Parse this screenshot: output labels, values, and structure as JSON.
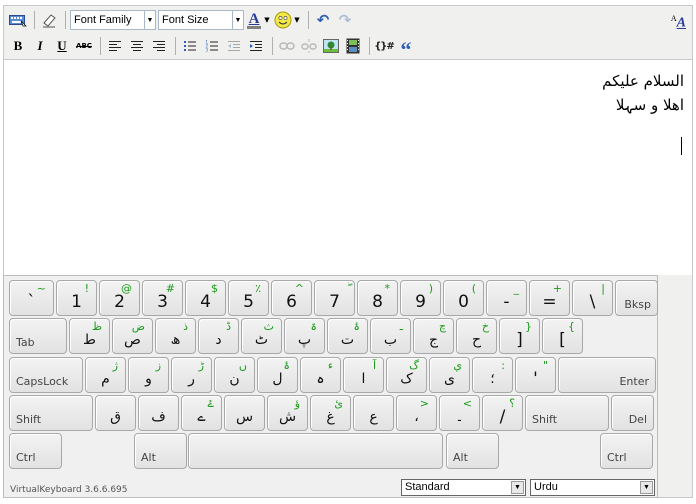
{
  "toolbar": {
    "row1": {
      "keyboard_icon": "keyboard-icon",
      "eraser_icon": "eraser-icon",
      "font_family": "Font Family",
      "font_size": "Font Size",
      "text_color_glyph": "A",
      "emoticon_glyph": "☺",
      "undo_glyph": "↶",
      "redo_glyph": "↷"
    },
    "row2": {
      "bold": "B",
      "italic": "I",
      "underline": "U",
      "strikethrough": "ABC",
      "quote_glyph": "“",
      "code_glyph": "{}#"
    },
    "format_glyph_small": "A",
    "format_glyph": "A"
  },
  "content": {
    "lines": [
      "السلام علیکم",
      "اهلا و سہلا"
    ]
  },
  "keyboard": {
    "rows": [
      [
        {
          "main": "`",
          "shift": "~"
        },
        {
          "main": "1",
          "shift": "!"
        },
        {
          "main": "2",
          "shift": "@"
        },
        {
          "main": "3",
          "shift": "#"
        },
        {
          "main": "4",
          "shift": "$"
        },
        {
          "main": "5",
          "shift": "٪"
        },
        {
          "main": "6",
          "shift": "^"
        },
        {
          "main": "7",
          "shift": "ۖ"
        },
        {
          "main": "8",
          "shift": "*"
        },
        {
          "main": "9",
          "shift": ")"
        },
        {
          "main": "0",
          "shift": "("
        },
        {
          "main": "-",
          "shift": "_"
        },
        {
          "main": "=",
          "shift": "+"
        },
        {
          "main": "\\",
          "shift": "|"
        },
        {
          "label": "Bksp"
        }
      ],
      [
        {
          "label": "Tab"
        },
        {
          "main": "ط",
          "shift": "ظ"
        },
        {
          "main": "ص",
          "shift": "ض"
        },
        {
          "main": "ھ",
          "shift": "ذ"
        },
        {
          "main": "د",
          "shift": "ڈ"
        },
        {
          "main": "ٹ",
          "shift": "ث"
        },
        {
          "main": "پ",
          "shift": "ۃ"
        },
        {
          "main": "ت",
          "shift": "ۂ"
        },
        {
          "main": "ب",
          "shift": "ـ"
        },
        {
          "main": "ج",
          "shift": "چ"
        },
        {
          "main": "ح",
          "shift": "خ"
        },
        {
          "main": "]",
          "shift": "}"
        },
        {
          "main": "[",
          "shift": "{"
        }
      ],
      [
        {
          "label": "CapsLock"
        },
        {
          "main": "م",
          "shift": "ژ"
        },
        {
          "main": "و",
          "shift": "ز"
        },
        {
          "main": "ر",
          "shift": "ڑ"
        },
        {
          "main": "ن",
          "shift": "ں"
        },
        {
          "main": "ل",
          "shift": "ۂ"
        },
        {
          "main": "ہ",
          "shift": "ء"
        },
        {
          "main": "ا",
          "shift": "آ"
        },
        {
          "main": "ک",
          "shift": "گ"
        },
        {
          "main": "ی",
          "shift": "ي"
        },
        {
          "main": "؛",
          "shift": ":"
        },
        {
          "main": "'",
          "shift": "\""
        },
        {
          "label": "Enter"
        }
      ],
      [
        {
          "label": "Shift"
        },
        {
          "main": "ق",
          "shift": ""
        },
        {
          "main": "ف",
          "shift": ""
        },
        {
          "main": "ے",
          "shift": "ۓ"
        },
        {
          "main": "س",
          "shift": ""
        },
        {
          "main": "ش",
          "shift": "ؤ"
        },
        {
          "main": "غ",
          "shift": "ئ"
        },
        {
          "main": "ع",
          "shift": ""
        },
        {
          "main": "،",
          "shift": ">"
        },
        {
          "main": "۔",
          "shift": "<"
        },
        {
          "main": "/",
          "shift": "؟"
        },
        {
          "label": "Shift"
        },
        {
          "label": "Del"
        }
      ],
      [
        {
          "label": "Ctrl"
        },
        {
          "label": "Alt"
        },
        {
          "label": ""
        },
        {
          "label": "Alt"
        },
        {
          "label": "Ctrl"
        }
      ]
    ],
    "footer": "VirtualKeyboard 3.6.6.695",
    "layout_select": "Standard",
    "language_select": "Urdu"
  },
  "colors": {
    "shift_char": "#1a9a1a",
    "toolbar_bg": "#f0f0ee",
    "keyboard_bg": "#f0f0f0"
  }
}
